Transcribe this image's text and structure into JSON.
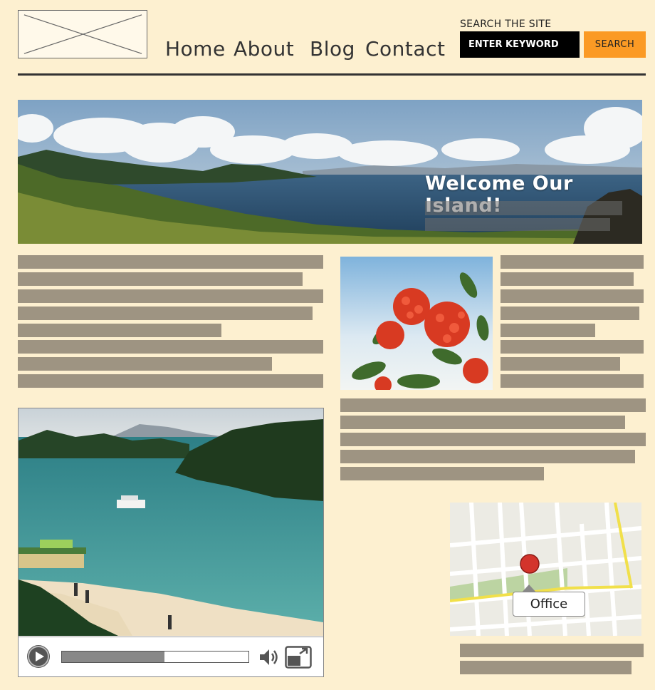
{
  "header": {
    "logo": "logo-placeholder",
    "nav": [
      "Home",
      "About",
      "Blog",
      "Contact"
    ],
    "search_label": "SEARCH THE SITE",
    "search_placeholder": "ENTER KEYWORD",
    "search_button": "SEARCH"
  },
  "hero": {
    "title": "Welcome Our Island!"
  },
  "map": {
    "label": "Office"
  },
  "video": {
    "progress": 0.55
  },
  "colors": {
    "background": "#fdf0d0",
    "accent": "#fb9a24",
    "placeholder_text": "#9e9482"
  }
}
